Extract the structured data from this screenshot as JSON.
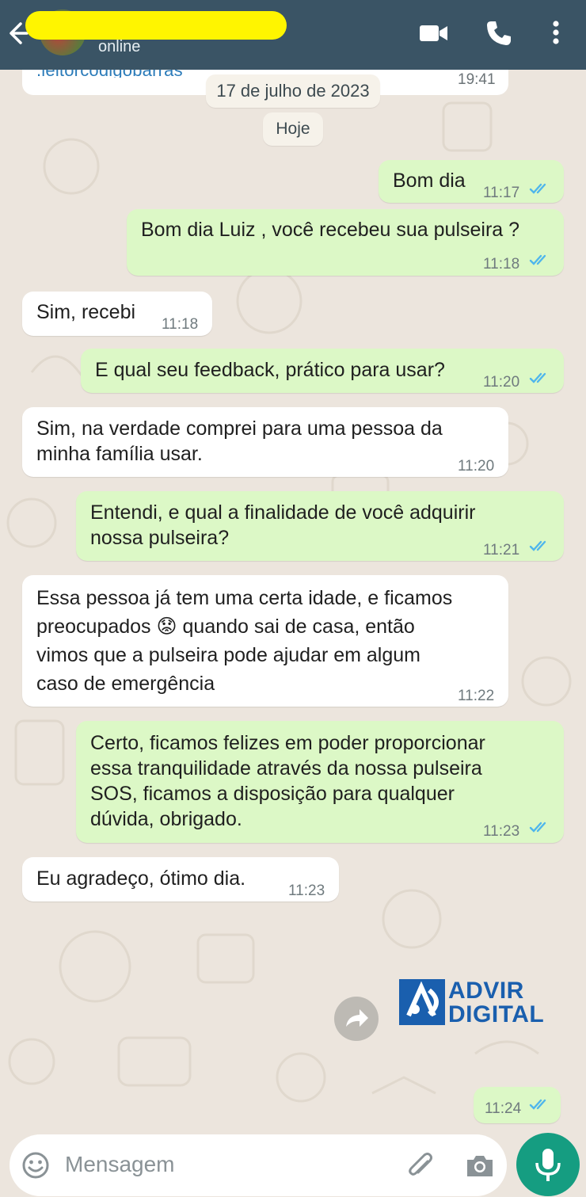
{
  "header": {
    "status": "online",
    "icons": [
      "back-arrow-icon",
      "video-call-icon",
      "phone-icon",
      "more-vert-icon"
    ]
  },
  "previous_message": {
    "text": ".leitorcodigobarras",
    "time": "19:41"
  },
  "date_chips": {
    "previous": "17 de julho de 2023",
    "today": "Hoje"
  },
  "messages": [
    {
      "dir": "out",
      "text": "Bom dia",
      "time": "11:17"
    },
    {
      "dir": "out",
      "text": "Bom dia Luiz , você recebeu sua pulseira ?",
      "time": "11:18"
    },
    {
      "dir": "in",
      "text": "Sim, recebi",
      "time": "11:18"
    },
    {
      "dir": "out",
      "text": "E qual seu feedback, prático para usar?",
      "time": "11:20"
    },
    {
      "dir": "in",
      "text": "Sim, na verdade comprei para uma pessoa da\nminha família usar.",
      "time": "11:20"
    },
    {
      "dir": "out",
      "text": "Entendi, e qual a finalidade de você adquirir\nnossa pulseira?",
      "time": "11:21"
    },
    {
      "dir": "in",
      "text": "Essa pessoa já tem uma certa idade, e ficamos\npreocupados 😟 quando sai de casa, então\nvimos que a pulseira pode ajudar em algum\ncaso de emergência",
      "time": "11:22"
    },
    {
      "dir": "out",
      "text": "Certo, ficamos felizes em poder proporcionar\nessa tranquilidade através da nossa pulseira\nSOS, ficamos a disposição para qualquer\ndúvida, obrigado.",
      "time": "11:23"
    },
    {
      "dir": "in",
      "text": "Eu agradeço,  ótimo dia.",
      "time": "11:23"
    },
    {
      "dir": "out",
      "text": "",
      "time": "11:24"
    }
  ],
  "logo": {
    "line1": "ADVIR",
    "line2": "DIGITAL",
    "color": "#1a5fae"
  },
  "input": {
    "placeholder": "Mensagem",
    "icons": [
      "emoji-icon",
      "attach-icon",
      "camera-icon",
      "mic-icon"
    ]
  },
  "colors": {
    "header": "#3a5465",
    "outgoing_bubble": "#dcf8c6",
    "incoming_bubble": "#ffffff",
    "read_ticks": "#4fb6ec",
    "mic_button": "#159d81"
  }
}
